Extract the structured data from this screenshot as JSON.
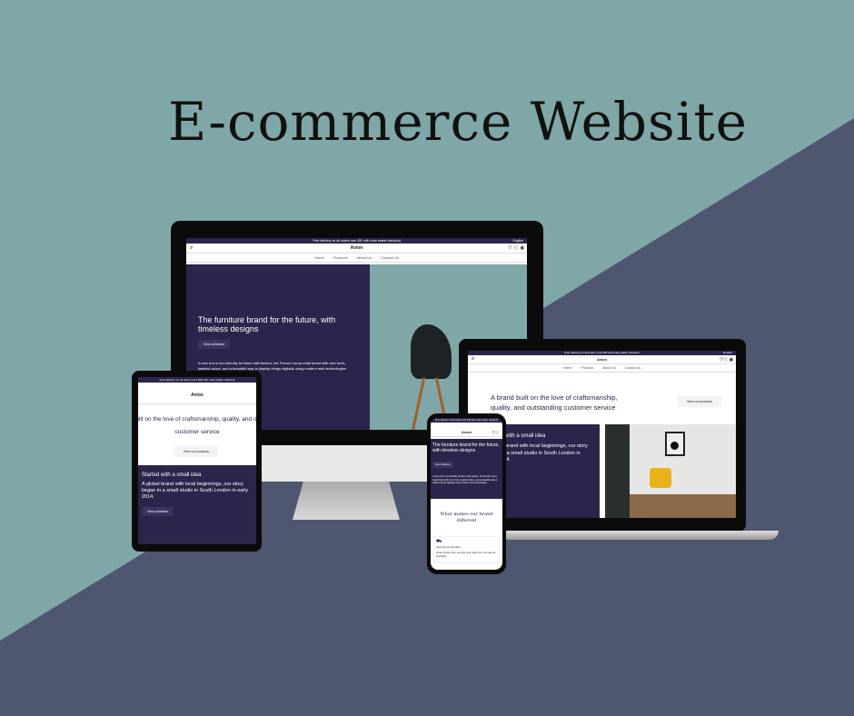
{
  "title": "E-commerce Website",
  "site": {
    "banner": "Free delivery on all orders over £50 with code easter checkout",
    "language": "English",
    "brand": "Avion",
    "nav": [
      "Home",
      "Products",
      "About Us",
      "Contact Us"
    ],
    "hero_heading": "The furniture brand for the future, with timeless designs",
    "view_collection": "View collection",
    "hero_text": "A new era in eco-friendly furniture with Avelon, the French luxury retail brand with nice fonts, tasteful colors, and a beautiful way to display things digitally using modern web technologies",
    "brand_heading": "A brand built on the love of craftsmanship, quality, and outstanding customer service",
    "view_products": "View our products",
    "story_heading": "Started with a small idea",
    "story_text": "A global brand with local beginnings, our story began in a small studio in South London in early 2014.",
    "different_heading": "What makes our brand different",
    "feature_title": "Next day as standard",
    "feature_text": "Order before 3pm and get your order the next day as standard"
  },
  "colors": {
    "teal": "#7fa7a8",
    "slate": "#4e5670",
    "brand_dark": "#2a254b"
  }
}
